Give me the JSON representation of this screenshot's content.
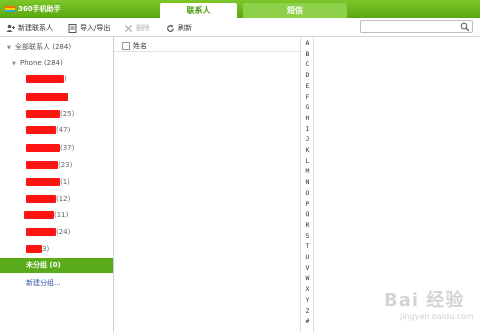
{
  "app": {
    "title": "360手机助手",
    "tabs": [
      {
        "label": "联系人",
        "active": true
      },
      {
        "label": "短信",
        "active": false
      }
    ]
  },
  "toolbar": {
    "new_contact": "新建联系人",
    "import_export": "导入/导出",
    "delete": "删除",
    "refresh": "刷新",
    "search_placeholder": ""
  },
  "sidebar": {
    "all_contacts": "全部联系人 (284)",
    "phone": "Phone (284)",
    "groups": [
      {
        "suffix": ")"
      },
      {
        "suffix": ""
      },
      {
        "suffix": "(25)"
      },
      {
        "suffix": "(47)"
      },
      {
        "suffix": "(37)"
      },
      {
        "suffix": "(23)"
      },
      {
        "suffix": "(1)"
      },
      {
        "suffix": "(12)"
      },
      {
        "suffix": "(11)"
      },
      {
        "suffix": "(24)"
      },
      {
        "suffix": "3)"
      }
    ],
    "ungrouped": "未分组 (0)",
    "new_group": "新建分组..."
  },
  "list": {
    "column_name": "姓名"
  },
  "alphabet": [
    "A",
    "B",
    "C",
    "D",
    "E",
    "F",
    "G",
    "H",
    "I",
    "J",
    "K",
    "L",
    "M",
    "N",
    "O",
    "P",
    "Q",
    "R",
    "S",
    "T",
    "U",
    "V",
    "W",
    "X",
    "Y",
    "Z",
    "#"
  ],
  "watermark": {
    "text": "Bai 经验",
    "sub": "jingyan.baidu.com"
  },
  "colors": {
    "brand_green": "#5aa80f",
    "selected_green": "#5aab1a",
    "redaction": "#ff1414"
  }
}
